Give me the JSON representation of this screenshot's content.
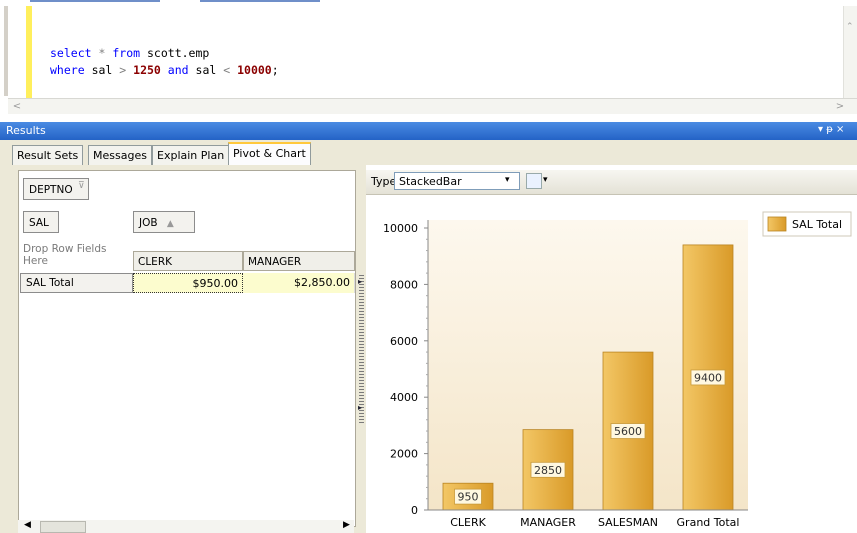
{
  "editor": {
    "line1": {
      "kw1": "select",
      "star": "*",
      "kw2": "from",
      "rest": "scott.emp"
    },
    "line2": {
      "kw1": "where",
      "col1": "sal",
      "gt": ">",
      "n1": "1250",
      "kw2": "and",
      "col2": "sal",
      "lt": "<",
      "n2": "10000",
      "semi": ";"
    }
  },
  "results": {
    "title": "Results",
    "controls": "▾ ᵽ ×"
  },
  "tabs": [
    {
      "label": "Result Sets"
    },
    {
      "label": "Messages"
    },
    {
      "label": "Explain Plan"
    },
    {
      "label": "Pivot & Chart",
      "active": true
    }
  ],
  "pivot": {
    "filter_field": "DEPTNO",
    "data_field": "SAL",
    "column_field": "JOB",
    "drop_hint": "Drop Row Fields Here",
    "col_headers": [
      "CLERK",
      "MANAGER"
    ],
    "row_label": "SAL Total",
    "cells": [
      "$950.00",
      "$2,850.00"
    ]
  },
  "chart_toolbar": {
    "type_label": "Type",
    "type_value": "StackedBar"
  },
  "chart_data": {
    "type": "bar",
    "categories": [
      "CLERK",
      "MANAGER",
      "SALESMAN",
      "Grand Total"
    ],
    "series": [
      {
        "name": "SAL Total",
        "values": [
          950,
          2850,
          5600,
          9400
        ]
      }
    ],
    "ylim": [
      0,
      10000
    ],
    "yticks": [
      0,
      2000,
      4000,
      6000,
      8000,
      10000
    ],
    "legend": "top-right",
    "bar_color": "#e1a83a"
  }
}
